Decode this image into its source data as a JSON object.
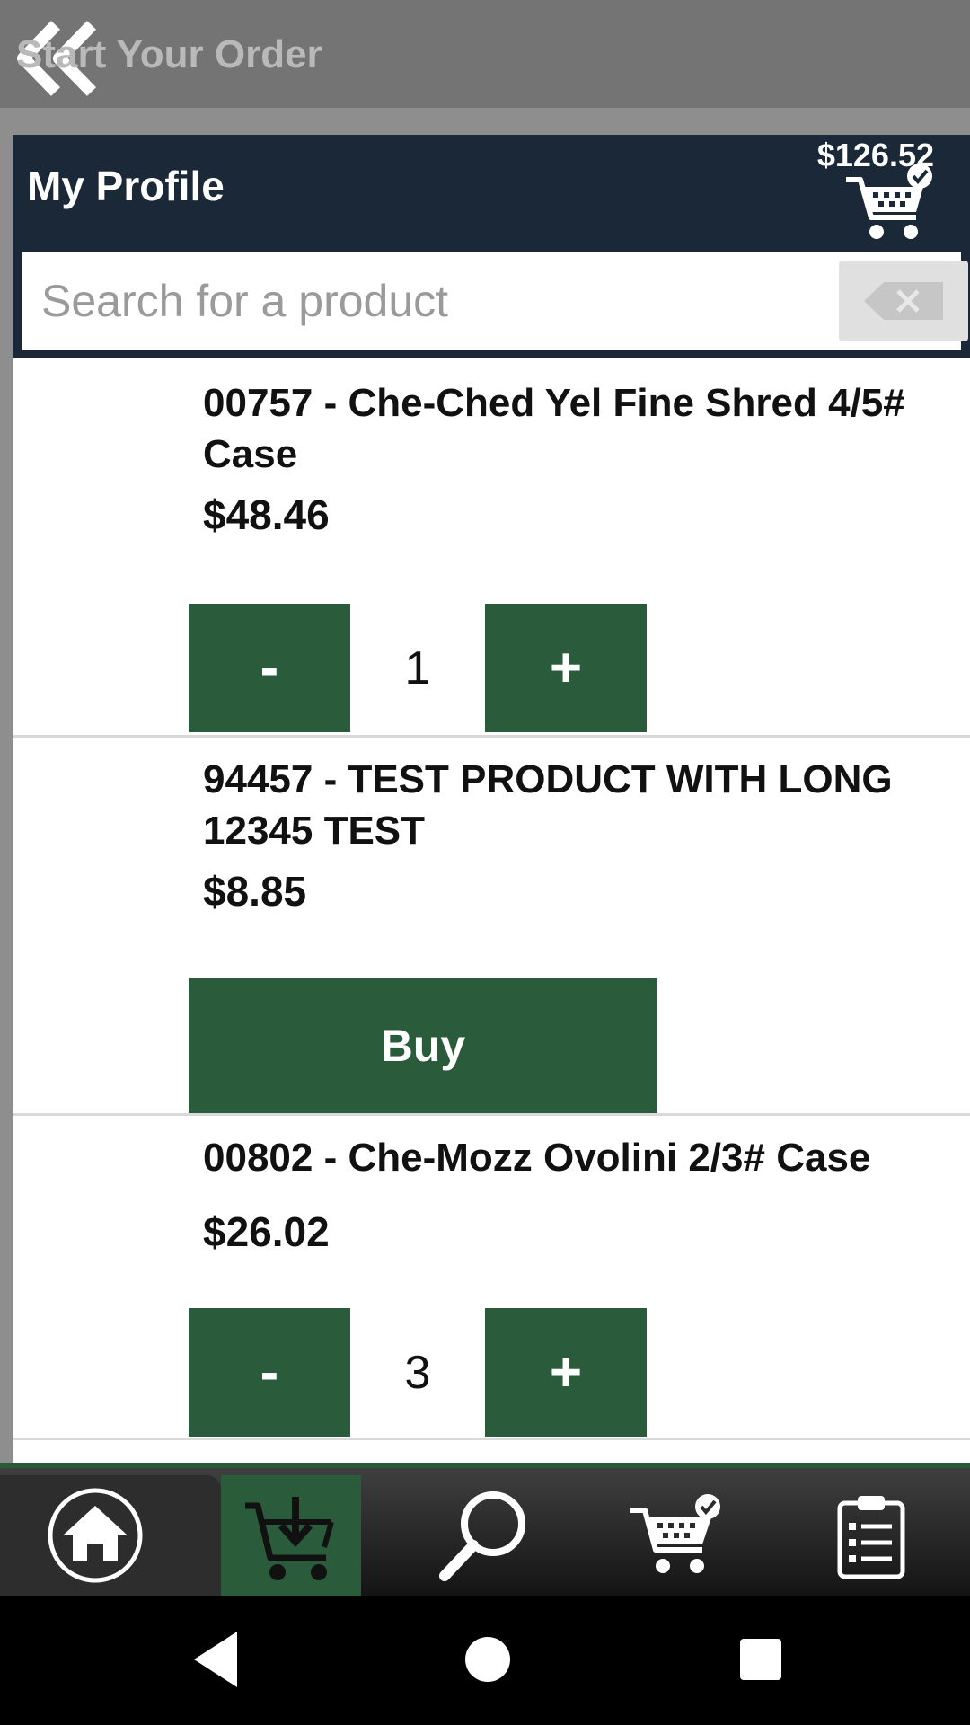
{
  "app_bar": {
    "title": "Start Your Order",
    "back_icon": "double-chevron-left-icon"
  },
  "header": {
    "title": "My Profile",
    "cart_total": "$126.52",
    "cart_icon": "cart-check-icon"
  },
  "search": {
    "placeholder": "Search for a product",
    "value": "",
    "clear_icon": "backspace-clear-icon"
  },
  "products": [
    {
      "name": "00757 - Che-Ched Yel Fine Shred 4/5# Case",
      "price": "$48.46",
      "quantity": "1",
      "minus_label": "-",
      "plus_label": "+"
    },
    {
      "name": "94457 - TEST PRODUCT WITH LONG 12345 TEST",
      "price": "$8.85",
      "buy_label": "Buy"
    },
    {
      "name": "00802 - Che-Mozz Ovolini 2/3# Case",
      "price": "$26.02",
      "quantity": "3",
      "minus_label": "-",
      "plus_label": "+"
    }
  ],
  "bottom_nav": {
    "items": [
      {
        "icon": "home-icon",
        "active": false
      },
      {
        "icon": "cart-download-icon",
        "active": true
      },
      {
        "icon": "search-icon",
        "active": false
      },
      {
        "icon": "cart-check-icon",
        "active": false
      },
      {
        "icon": "clipboard-list-icon",
        "active": false
      }
    ]
  },
  "system_nav": {
    "items": [
      "back-triangle-icon",
      "home-circle-icon",
      "recents-square-icon"
    ]
  },
  "colors": {
    "accent_green": "#2a5c3c",
    "header_navy": "#1a2838",
    "appbar_gray": "#747474"
  }
}
